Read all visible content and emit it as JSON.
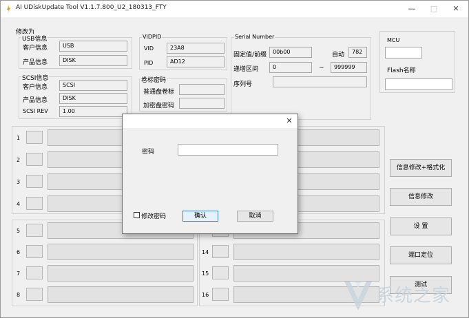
{
  "window": {
    "title": "AI UDiskUpdate Tool V1.1.7.800_U2_180313_FTY",
    "minimize": "—",
    "maximize": "□",
    "close": "✕"
  },
  "modify": {
    "caption": "修改为",
    "usb": {
      "title": "USB信息",
      "vendor_label": "客户信息",
      "vendor_value": "USB",
      "product_label": "产品信息",
      "product_value": "DISK"
    },
    "scsi": {
      "title": "SCSI信息",
      "vendor_label": "客户信息",
      "vendor_value": "SCSI",
      "product_label": "产品信息",
      "product_value": "DISK",
      "rev_label": "SCSI REV",
      "rev_value": "1.00"
    },
    "vidpid": {
      "title": "VIDPID",
      "vid_label": "VID",
      "vid_value": "23A8",
      "pid_label": "PID",
      "pid_value": "AD12"
    },
    "volume": {
      "title": "卷标密码",
      "normal_label": "普通盘卷标",
      "normal_value": "",
      "encrypted_label": "加密盘密码",
      "encrypted_value": ""
    },
    "serial": {
      "title": "Serial Number",
      "prefix_label": "固定值/前缀",
      "prefix_value": "00b00",
      "auto_label": "自动",
      "auto_value": "782",
      "range_label": "递增区间",
      "range_from": "0",
      "range_sep": "~",
      "range_to": "999999",
      "seq_label": "序列号",
      "seq_value": ""
    }
  },
  "mcu": {
    "title": "MCU",
    "value": "",
    "flash_label": "Flash名称",
    "flash_value": ""
  },
  "slots": {
    "left": [
      "1",
      "2",
      "3",
      "4",
      "5",
      "6",
      "7",
      "8"
    ],
    "right": [
      "14",
      "15",
      "16"
    ]
  },
  "buttons": {
    "modify_format": "信息修改+格式化",
    "modify": "信息修改",
    "settings": "设 置",
    "port_locate": "端口定位",
    "test": "测试"
  },
  "dialog": {
    "close": "✕",
    "password_label": "密码",
    "password_value": "",
    "change_password_label": "修改密码",
    "ok_label": "确认",
    "cancel_label": "取消"
  },
  "watermark": {
    "text": "系统之家"
  },
  "colors": {
    "window_bg": "#f0f0f0",
    "titlebar_bg": "#ffffff",
    "field_border": "#a8a8a8",
    "focus_border": "#3c7fd4",
    "watermark": "#c8d3dd"
  }
}
